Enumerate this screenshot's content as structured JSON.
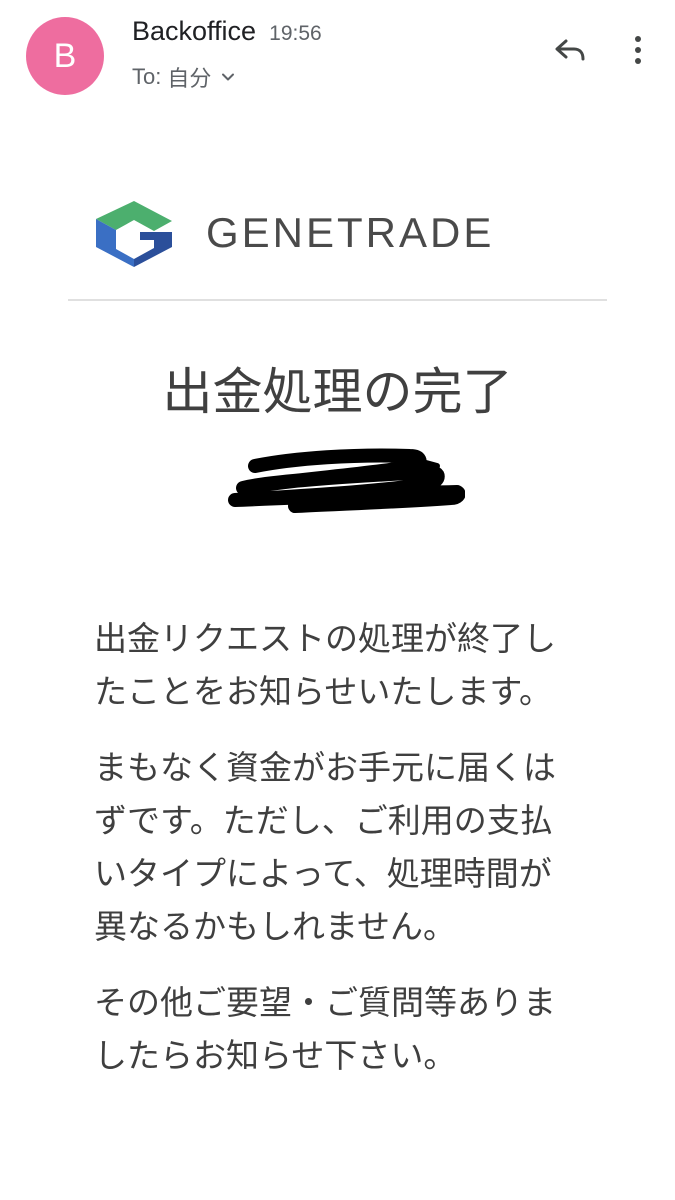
{
  "header": {
    "avatar_letter": "B",
    "sender_name": "Backoffice",
    "time": "19:56",
    "recipient_prefix": "To:",
    "recipient_name": "自分",
    "reply_icon": "reply-icon",
    "more_icon": "more-vert-icon",
    "chevron_icon": "chevron-down-icon"
  },
  "email": {
    "brand_name": "GENETRADE",
    "title": "出金処理の完了",
    "paragraphs": [
      "出金リクエストの処理が終了したことをお知らせいたします。",
      "まもなく資金がお手元に届くはずです。ただし、ご利用の支払いタイプによって、処理時間が異なるかもしれません。",
      "その他ご要望・ご質問等ありましたらお知らせ下さい。"
    ]
  },
  "colors": {
    "avatar": "#ee6d9f",
    "logo_green": "#4caf6e",
    "logo_blue": "#3a6fc4",
    "logo_dark_blue": "#2b4f9a",
    "text": "#3f3f3f"
  }
}
